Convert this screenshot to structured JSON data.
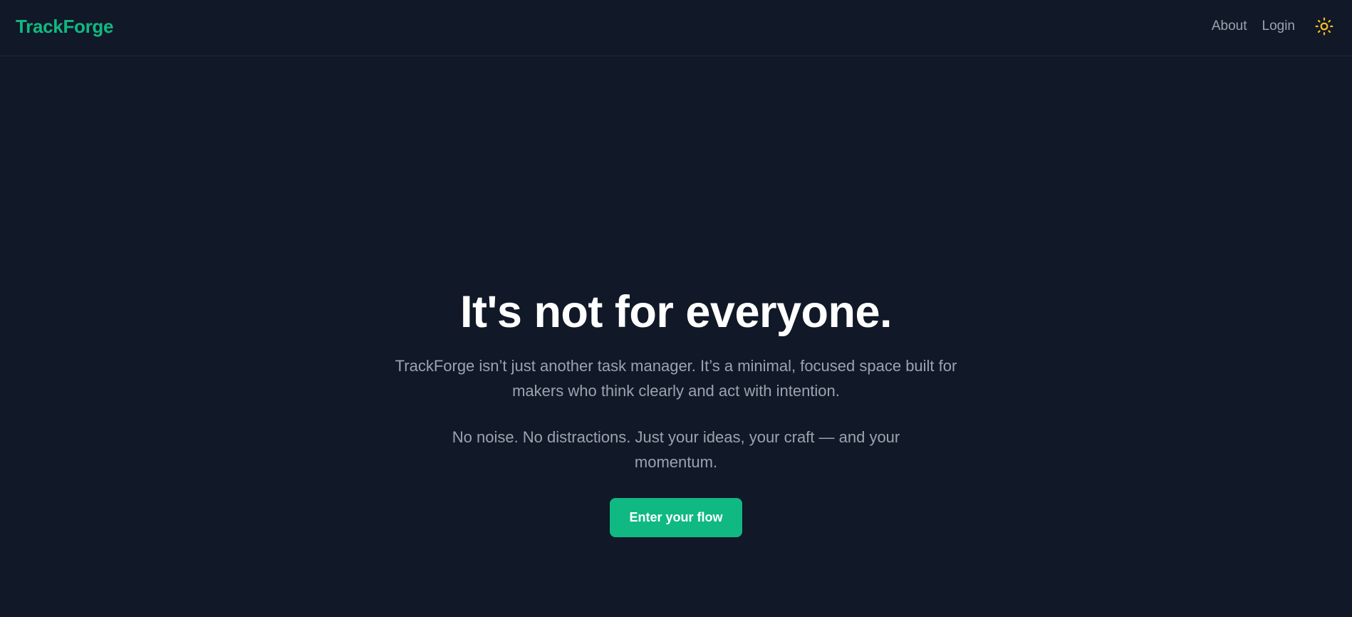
{
  "header": {
    "brand": "TrackForge",
    "nav": {
      "about": "About",
      "login": "Login"
    },
    "theme_toggle_icon": "sun-icon"
  },
  "hero": {
    "title": "It's not for everyone.",
    "paragraph1": "TrackForge isn’t just another task manager. It’s a minimal, focused space built for makers who think clearly and act with intention.",
    "paragraph2": "No noise. No distractions. Just your ideas, your craft — and your momentum.",
    "cta_label": "Enter your flow"
  },
  "colors": {
    "background": "#111827",
    "brand": "#10b981",
    "heading": "#ffffff",
    "body_text": "#9ca3af",
    "sun_icon": "#fbbf24"
  }
}
